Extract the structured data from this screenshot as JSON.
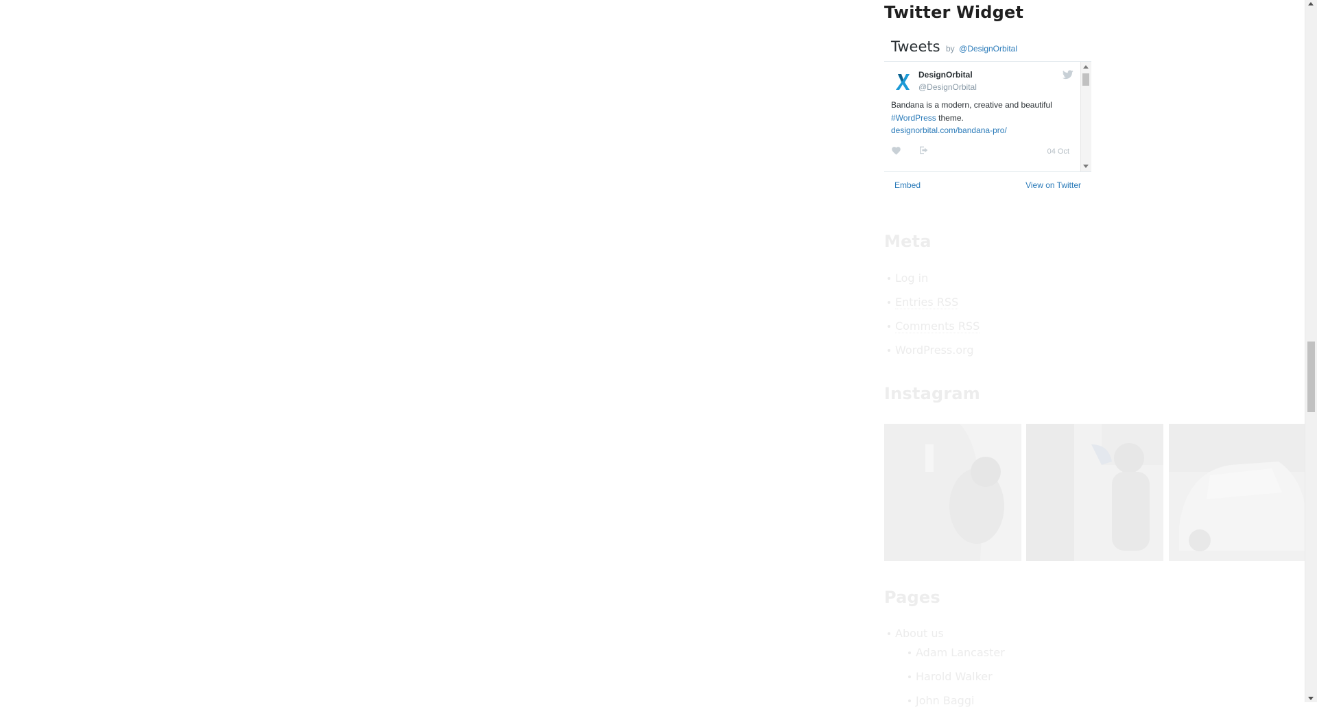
{
  "twitter_widget": {
    "title": "Twitter Widget",
    "header_title": "Tweets",
    "header_by": "by",
    "header_handle": "@DesignOrbital",
    "tweet": {
      "author_name": "DesignOrbital",
      "author_handle": "@DesignOrbital",
      "text_line1": "Bandana is a modern, creative and beautiful",
      "hashtag": "#WordPress",
      "text_after_hashtag": " theme.",
      "link": "designorbital.com/bandana-pro/",
      "date": "04 Oct"
    },
    "footer_embed": "Embed",
    "footer_view": "View on Twitter"
  },
  "meta_widget": {
    "title": "Meta",
    "items": [
      {
        "label": "Log in",
        "abbr": ""
      },
      {
        "label": "Entries ",
        "abbr": "RSS"
      },
      {
        "label": "Comments ",
        "abbr": "RSS"
      },
      {
        "label": "WordPress.org",
        "abbr": ""
      }
    ]
  },
  "instagram_widget": {
    "title": "Instagram",
    "photos": [
      "instagram-photo-1",
      "instagram-photo-2",
      "instagram-photo-3"
    ]
  },
  "pages_widget": {
    "title": "Pages",
    "items": [
      "About us"
    ],
    "subitems": [
      "Adam Lancaster",
      "Harold Walker",
      "John Baggi"
    ]
  },
  "colors": {
    "twitter_link": "#2b7bb9",
    "heading": "#1f1f1f",
    "faded_text": "#ececec"
  }
}
